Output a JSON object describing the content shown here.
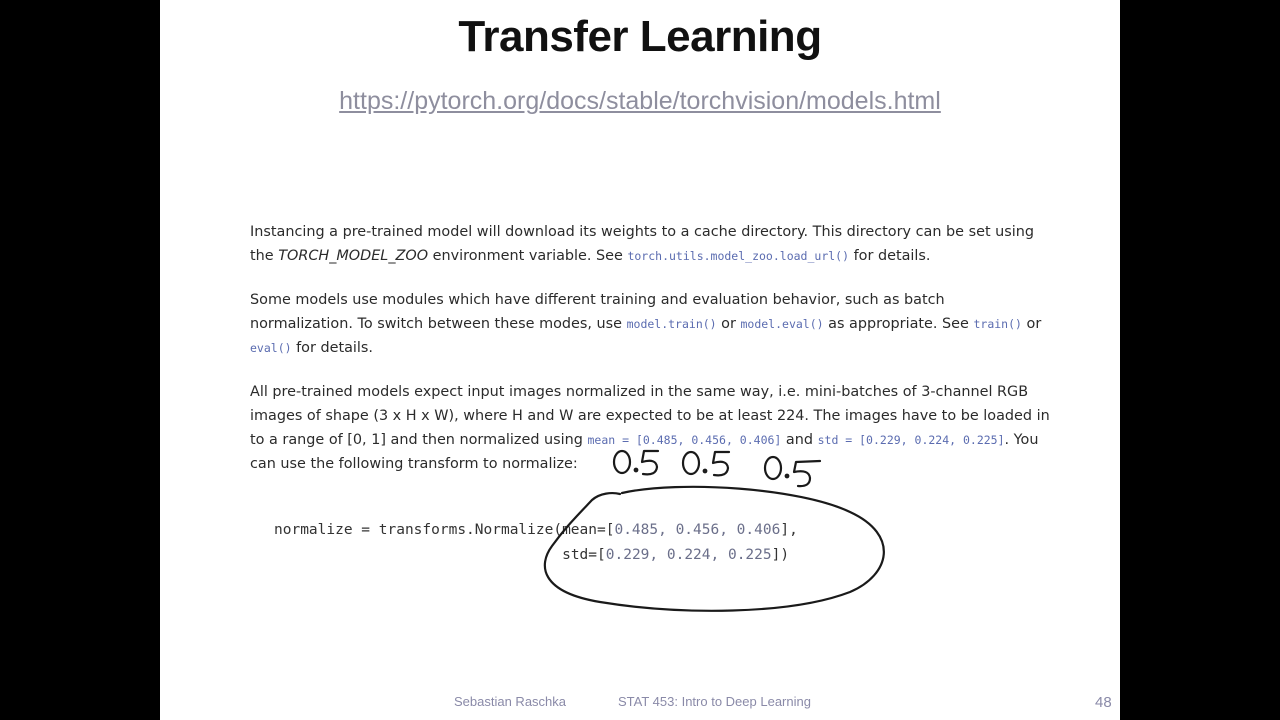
{
  "slide": {
    "title": "Transfer Learning",
    "url": "https://pytorch.org/docs/stable/torchvision/models.html",
    "para1": {
      "t1": "Instancing a pre-trained model will download its weights to a cache directory. This directory can be set using the ",
      "env_var": "TORCH_MODEL_ZOO",
      "t2": " environment variable. See ",
      "code1": "torch.utils.model_zoo.load_url()",
      "t3": " for details."
    },
    "para2": {
      "t1": "Some models use modules which have different training and evaluation behavior, such as batch normalization. To switch between these modes, use ",
      "code1": "model.train()",
      "t2": " or ",
      "code2": "model.eval()",
      "t3": " as appropriate. See ",
      "code3": "train()",
      "t4": " or ",
      "code4": "eval()",
      "t5": " for details."
    },
    "para3": {
      "t1": "All pre-trained models expect input images normalized in the same way, i.e. mini-batches of 3-channel RGB images of shape (3 x H x W), where H and W are expected to be at least 224. The images have to be loaded in to a range of [0, 1] and then normalized using ",
      "code1": "mean = [0.485, 0.456, 0.406]",
      "t2": " and ",
      "code2": "std = [0.229, 0.224, 0.225]",
      "t3": ". You can use the following transform to normalize:"
    },
    "code": {
      "line1_prefix": "normalize = transforms.Normalize(mean=[",
      "mean_values": "0.485, 0.456, 0.406",
      "line1_suffix": "],",
      "line2_prefix": "std=[",
      "std_values": "0.229, 0.224, 0.225",
      "line2_suffix": "])"
    },
    "annotation": {
      "handwritten": "0.5 0.5 0.5",
      "ink_color": "#1a1a1a"
    },
    "footer": {
      "author": "Sebastian Raschka",
      "course": "STAT 453: Intro to Deep Learning",
      "page": "48"
    }
  }
}
